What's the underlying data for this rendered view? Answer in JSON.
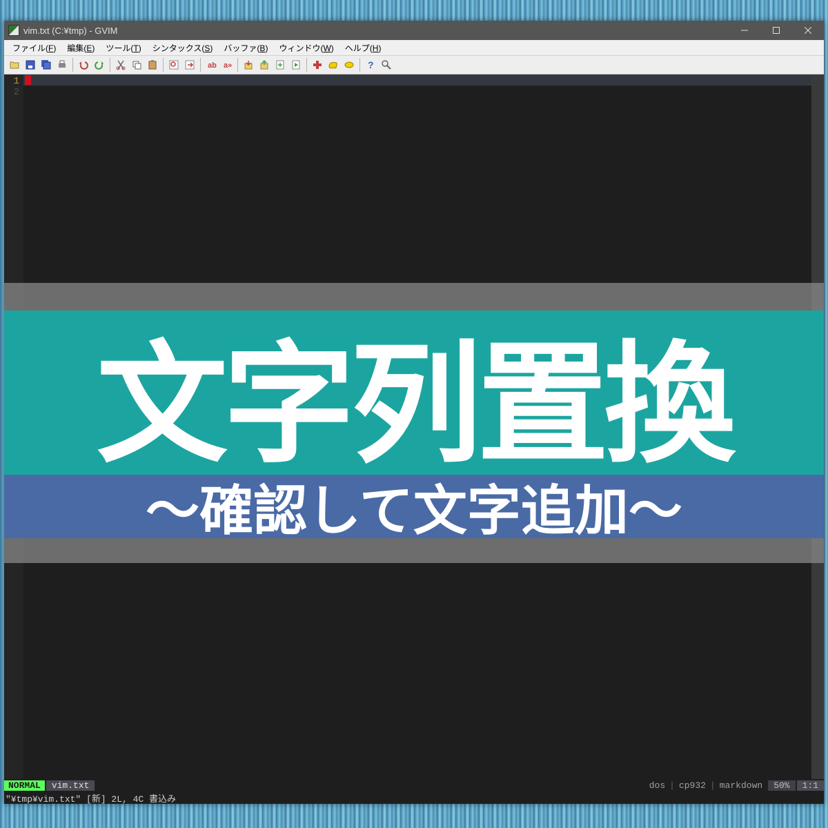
{
  "title": "vim.txt (C:¥tmp) - GVIM",
  "menus": {
    "file": {
      "label": "ファイル",
      "key": "F"
    },
    "edit": {
      "label": "編集",
      "key": "E"
    },
    "tools": {
      "label": "ツール",
      "key": "T"
    },
    "syntax": {
      "label": "シンタックス",
      "key": "S"
    },
    "buffer": {
      "label": "バッファ",
      "key": "B"
    },
    "window": {
      "label": "ウィンドウ",
      "key": "W"
    },
    "help": {
      "label": "ヘルプ",
      "key": "H"
    }
  },
  "toolbar_icons": [
    "open-icon",
    "save-icon",
    "saveall-icon",
    "print-icon",
    "sep",
    "undo-icon",
    "redo-icon",
    "sep",
    "cut-icon",
    "copy-icon",
    "paste-icon",
    "sep",
    "find-icon",
    "findnext-icon",
    "sep",
    "replace-icon",
    "replaceall-icon",
    "sep",
    "load-session-icon",
    "save-session-icon",
    "new-script-icon",
    "run-script-icon",
    "sep",
    "make-icon",
    "shell-icon",
    "tag-jump-icon",
    "sep",
    "help-icon",
    "find-help-icon"
  ],
  "gutter": {
    "line1": "1",
    "line2": "2"
  },
  "status": {
    "mode": "NORMAL",
    "filename": "vim.txt",
    "os": "dos",
    "encoding": "cp932",
    "filetype": "markdown",
    "percent": "50%",
    "position": "1:1"
  },
  "cmdline": "\"¥tmp¥vim.txt\" [新] 2L, 4C 書込み",
  "overlay": {
    "main": "文字列置換",
    "sub": "～確認して文字追加～"
  }
}
